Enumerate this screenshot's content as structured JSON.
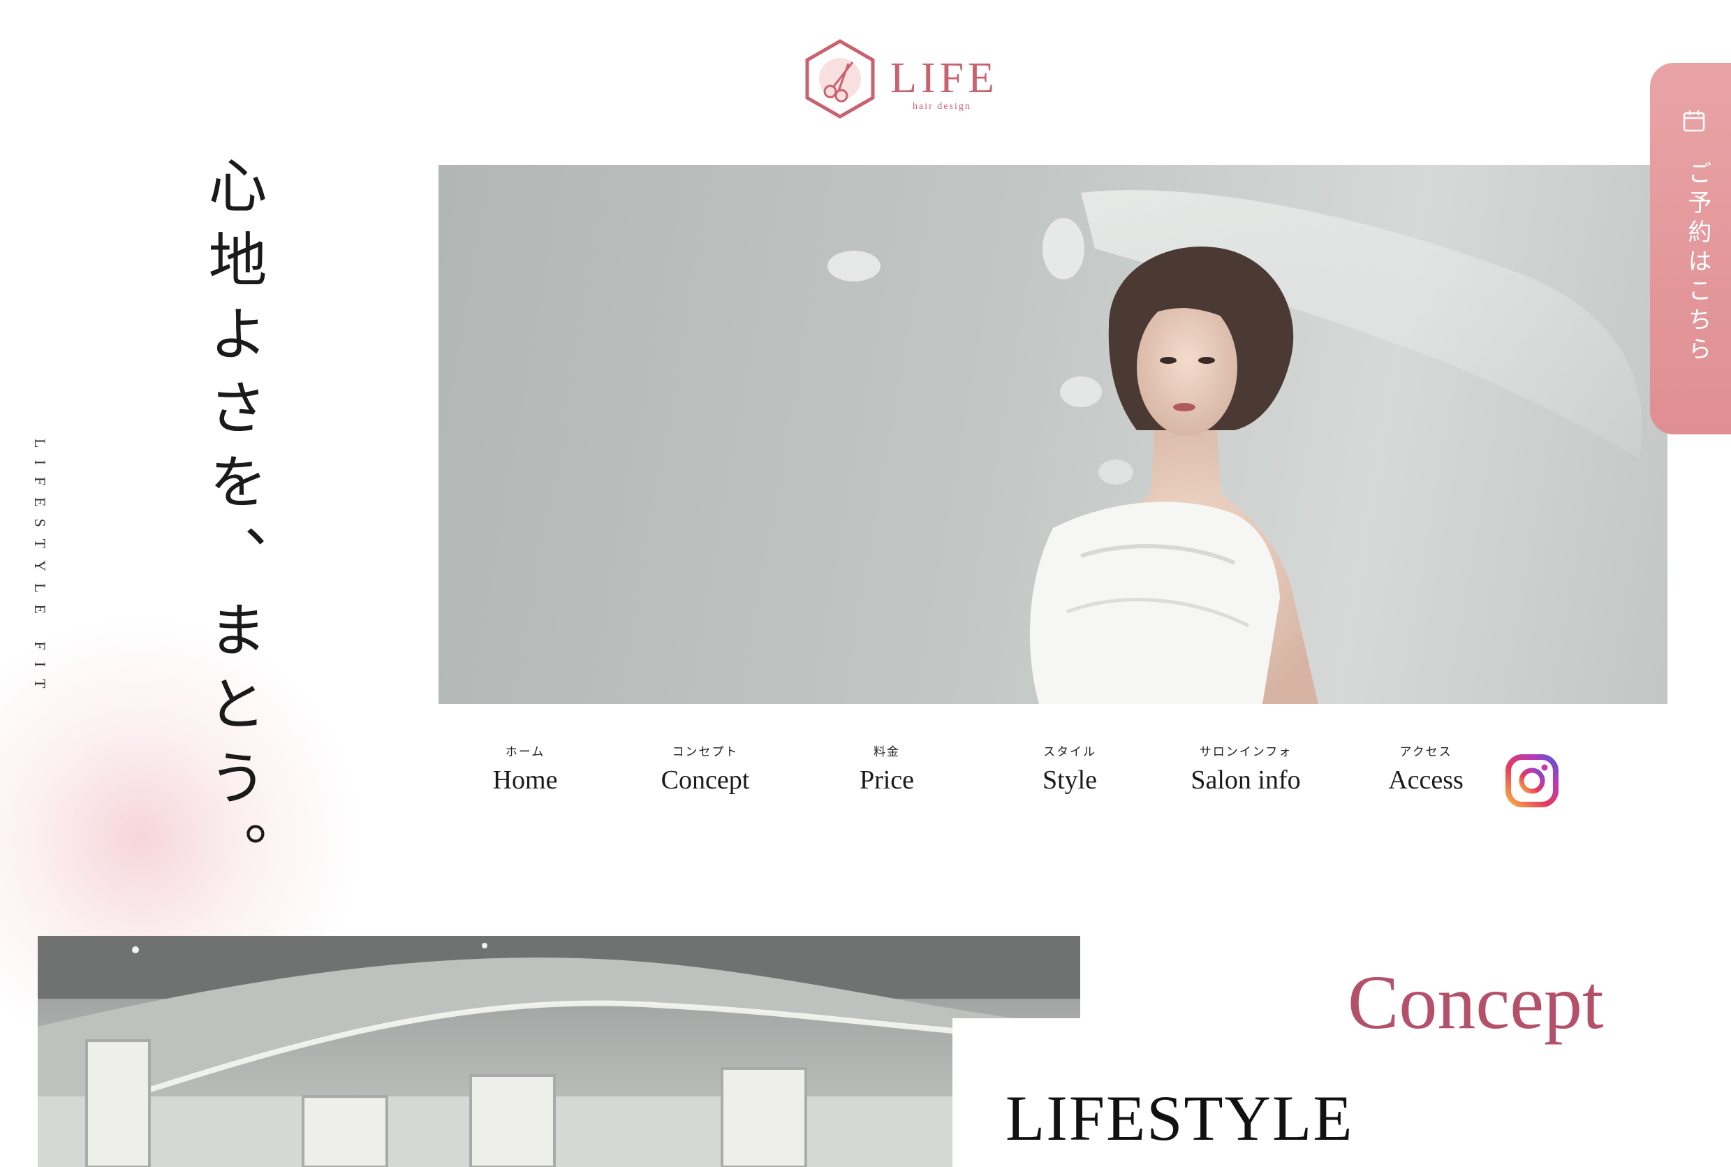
{
  "brand": {
    "name": "LIFE",
    "sub": "hair design"
  },
  "tagline": "心地よさを、まとう。",
  "side_text": "LIFESTYLE FIT",
  "reserve": {
    "label": "ご予約はこちら"
  },
  "nav": [
    {
      "jp": "ホーム",
      "en": "Home"
    },
    {
      "jp": "コンセプト",
      "en": "Concept"
    },
    {
      "jp": "料金",
      "en": "Price"
    },
    {
      "jp": "スタイル",
      "en": "Style"
    },
    {
      "jp": "サロンインフォ",
      "en": "Salon info"
    },
    {
      "jp": "アクセス",
      "en": "Access"
    }
  ],
  "concept": {
    "title": "Concept",
    "subtitle": "LIFESTYLE"
  },
  "colors": {
    "accent": "#c9626f",
    "reserve": "#e39a9d",
    "concept": "#b5506a"
  }
}
